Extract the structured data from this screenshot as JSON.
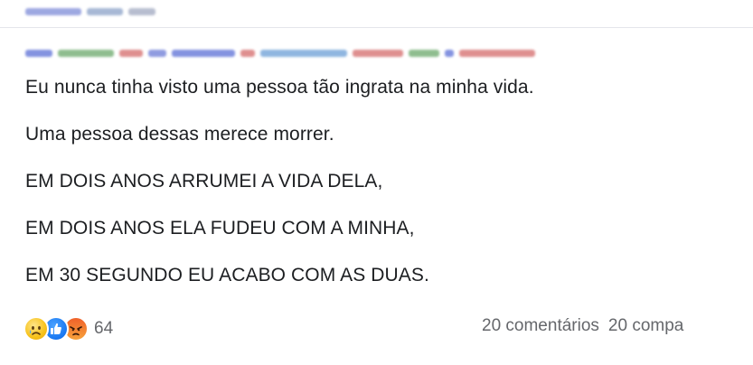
{
  "post": {
    "body_lines": [
      "Eu nunca tinha visto uma pessoa tão ingrata na minha vida.",
      "Uma pessoa dessas merece morrer.",
      "EM DOIS ANOS ARRUMEI A VIDA DELA,",
      "EM DOIS ANOS ELA FUDEU COM A MINHA,",
      "EM 30 SEGUNDO EU ACABO COM AS DUAS."
    ]
  },
  "footer": {
    "reactions": [
      "sad-icon",
      "like-icon",
      "angry-icon"
    ],
    "reaction_count": "64",
    "comments": "20 comentários",
    "shares": "20 compa"
  },
  "colors": {
    "text": "#1c1e21",
    "muted": "#65676b",
    "like_blue": "#1877f2",
    "blur_blue": "#5b6fd6",
    "blur_green": "#6aa86a",
    "blur_red": "#d46a6a"
  }
}
